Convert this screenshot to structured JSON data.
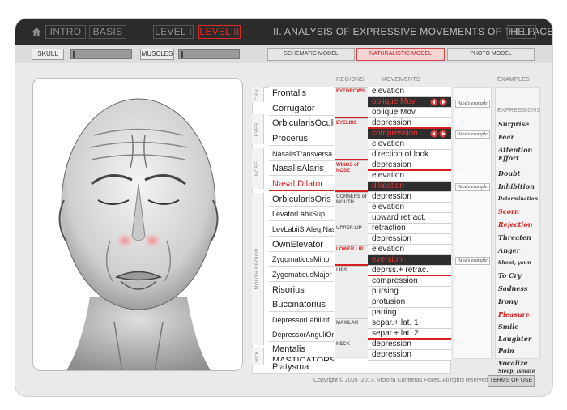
{
  "topbar": {
    "intro": "INTRO",
    "basis": "BASIS",
    "level1": "LEVEL I",
    "level2": "LEVEL II",
    "title": "II. ANALYSIS OF  EXPRESSIVE MOVEMENTS OF THE FACE",
    "help": "HELP"
  },
  "secbar": {
    "skull": "SKULL",
    "muscles": "MUSCLES",
    "schematic": "SCHEMATIC MODEL",
    "naturalistic": "NATURALISTIC MODEL",
    "photo": "PHOTO MODEL"
  },
  "headers": {
    "regions": "REGIONS",
    "movements": "MOVEMENTS",
    "examples": "EXAMPLES",
    "expressions": "EXPRESSIONS"
  },
  "vtabs": [
    "CRN",
    "EYES",
    "NOSE",
    "MOUTH REGION",
    "NCK"
  ],
  "muscles": [
    "Frontalis",
    "Corrugator",
    "OrbicularisOculi",
    "Procerus",
    "NasalisTransversa",
    "NasalisAlaris",
    "Nasal Dilator",
    "OrbicularisOris",
    "LevatorLabiiSup",
    "LevLabiiS.Aleq.Nasi",
    "OwnElevator",
    "ZygomaticusMinor",
    "ZygomaticusMajor",
    "Risorius",
    "Buccinatorius",
    "DepressorLabiiInf",
    "DepressorAnguliOris",
    "Mentalis",
    "MASTICATORS",
    "Platysma"
  ],
  "regions": [
    "EYEBROWS",
    "EYELIDS",
    "WINGS of NOSE",
    "CORNERS of MOUTH",
    "UPPER LIP",
    "LOWER LIP",
    "LIPS",
    "MAXILAR",
    "NECK"
  ],
  "movements": [
    "elevation",
    "oblique Mov.",
    "oblique Mov.",
    "depression",
    "compression",
    "elevation",
    "direction of look",
    "depression",
    "elevation",
    "dilatation",
    "depression",
    "elevation",
    "upward retract.",
    "retraction",
    "depression",
    "elevation",
    "eversion",
    "deprss.+ retrac.",
    "compression",
    "pursing",
    "protusion",
    "parting",
    "separ.+ lat. 1",
    "separ.+ lat.  2",
    "depression",
    "depression"
  ],
  "example_tag": "Aina's example",
  "expressions": [
    "Surprise",
    "Fear",
    "Attention Effort",
    "Doubt",
    "Inhibition",
    "Determination",
    "Scorn",
    "Rejection",
    "Threaten",
    "Anger",
    "Shout, yawn",
    "To Cry",
    "Sadness",
    "Irony",
    "Pleasure",
    "Smile",
    "Laughter",
    "Pain",
    "Vocalize",
    "Sleep, Isolate"
  ],
  "footer": {
    "copyright": "Copyright © 2005 -2017. Victoria Contreras Flores.  All rights reserved.",
    "terms": "TERMS OF USE"
  },
  "colors": {
    "accent": "#d62020",
    "topbar": "#2b2b2b"
  }
}
